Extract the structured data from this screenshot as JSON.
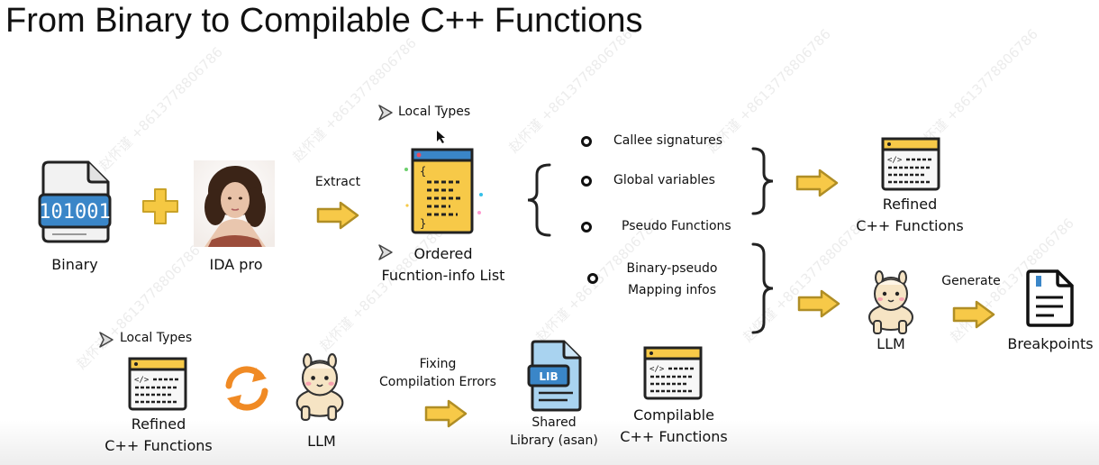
{
  "title": "From Binary to Compilable C++ Functions",
  "nodes": {
    "binary": "Binary",
    "binary_code": "101001",
    "ida": "IDA pro",
    "extract": "Extract",
    "local_types_top": "Local Types",
    "ordered_line1": "Ordered",
    "ordered_line2": "Fucntion-info List",
    "refined_top_line1": "Refined",
    "refined_top_line2": "C++ Functions",
    "generate": "Generate",
    "llm_right": "LLM",
    "breakpoints": "Breakpoints",
    "local_types_bottom": "Local Types",
    "refined_bottom_line1": "Refined",
    "refined_bottom_line2": "C++ Functions",
    "llm_bottom": "LLM",
    "fixing_line1": "Fixing",
    "fixing_line2": "Compilation Errors",
    "shared_line1": "Shared",
    "shared_line2": "Library (asan)",
    "lib_badge": "LIB",
    "compilable_line1": "Compilable",
    "compilable_line2": "C++ Functions"
  },
  "bullets": [
    "Callee signatures",
    "Global variables",
    "Pseudo Functions"
  ],
  "mapping": {
    "line1": "Binary-pseudo",
    "line2": "Mapping infos"
  },
  "watermark": "赵怀谨 +8613778806786",
  "colors": {
    "arrow_fill": "#f7c948",
    "arrow_stroke": "#c9a227",
    "plus": "#f5c842",
    "cycle": "#f08a24",
    "doc_blue": "#3a86c8",
    "code_yellow": "#f7c948"
  }
}
